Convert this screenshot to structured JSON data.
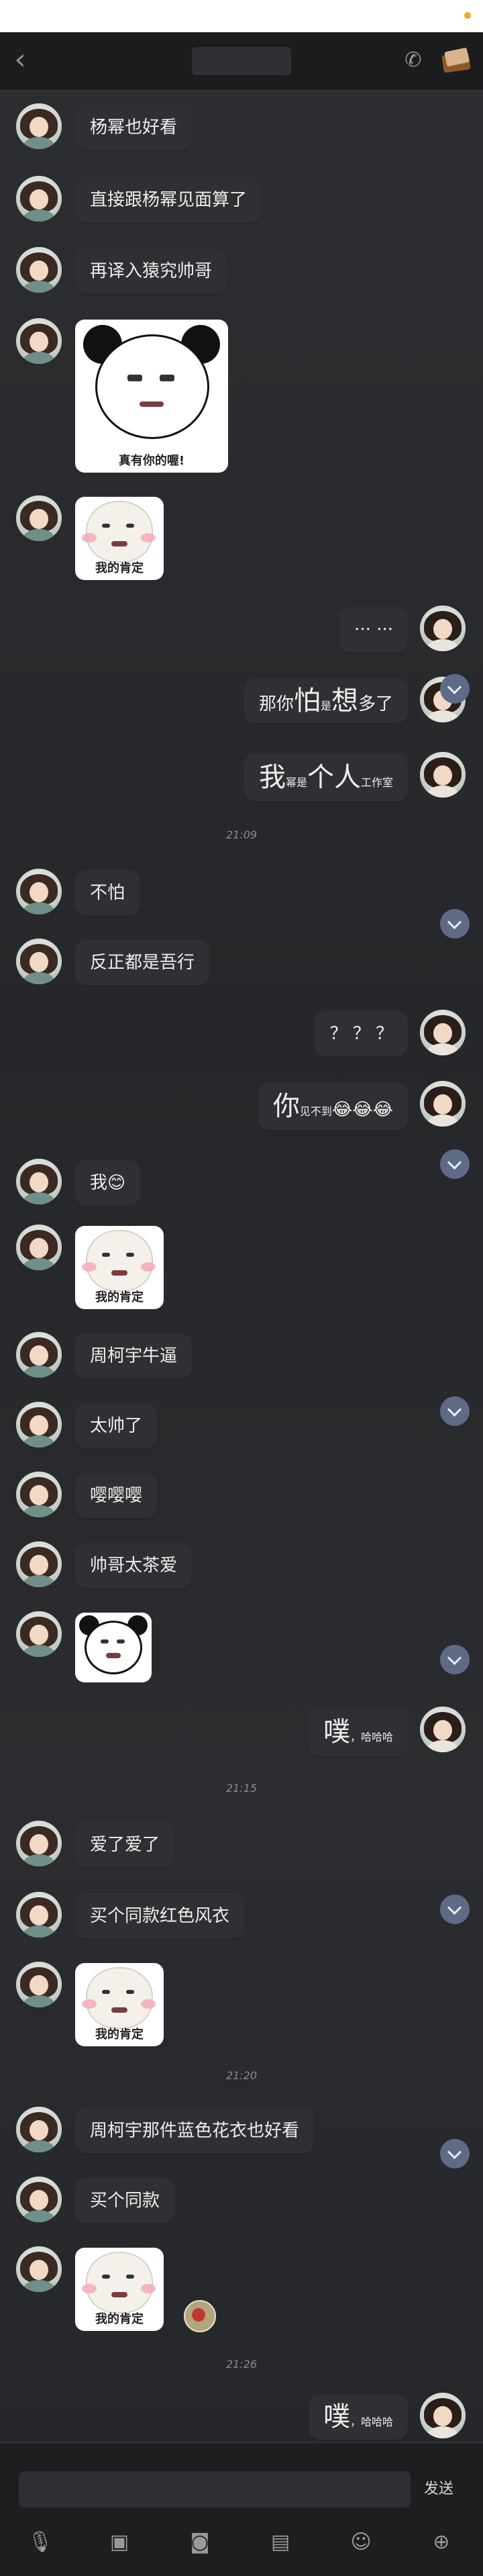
{
  "titlebar": {
    "back_icon": "chevron-left-icon",
    "title": "",
    "phone_icon": "phone-icon",
    "album_icon": "photo-album-icon"
  },
  "messages": [
    {
      "side": "left",
      "type": "text",
      "text": "杨幂也好看"
    },
    {
      "side": "left",
      "type": "text",
      "text": "直接跟杨幂见面算了"
    },
    {
      "side": "left",
      "type": "text",
      "text": "再译入猿究帅哥"
    },
    {
      "side": "left",
      "type": "sticker",
      "caption": "真有你的喔!"
    },
    {
      "side": "left",
      "type": "sticker",
      "caption": "我的肯定"
    },
    {
      "side": "right",
      "type": "text",
      "text": "··· ···"
    },
    {
      "side": "right",
      "type": "text",
      "text_a": "那你",
      "text_b": "怕",
      "text_c": "是",
      "text_d": "想",
      "text_e": "多了"
    },
    {
      "side": "right",
      "type": "text",
      "text_a": "我",
      "text_b": "幂是",
      "text_c": "个人",
      "text_d": "工作室"
    },
    {
      "time": "21:09"
    },
    {
      "side": "left",
      "type": "text",
      "text": "不怕"
    },
    {
      "side": "left",
      "type": "text",
      "text": "反正都是吾行"
    },
    {
      "side": "right",
      "type": "text",
      "text": "？ ？ ？"
    },
    {
      "side": "right",
      "type": "text",
      "text_a": "你",
      "text_b": "见不到",
      "text_c": "😂😂😂"
    },
    {
      "side": "left",
      "type": "text",
      "text": "我",
      "emoji": "😊"
    },
    {
      "side": "left",
      "type": "sticker",
      "caption": "我的肯定"
    },
    {
      "side": "left",
      "type": "text",
      "text": "周柯宇牛逼"
    },
    {
      "side": "left",
      "type": "text",
      "text": "太帅了"
    },
    {
      "side": "left",
      "type": "text",
      "text": "嘤嘤嘤"
    },
    {
      "side": "left",
      "type": "text",
      "text": "帅哥太茶爱"
    },
    {
      "side": "left",
      "type": "sticker",
      "caption": ""
    },
    {
      "side": "right",
      "type": "text",
      "text_a": "噗",
      "text_b": "，哈哈哈"
    },
    {
      "time": "21:15"
    },
    {
      "side": "left",
      "type": "text",
      "text": "爱了爱了"
    },
    {
      "side": "left",
      "type": "text",
      "text": "买个同款红色风衣"
    },
    {
      "side": "left",
      "type": "sticker",
      "caption": "我的肯定"
    },
    {
      "time": "21:20"
    },
    {
      "side": "left",
      "type": "text",
      "text": "周柯宇那件蓝色花衣也好看"
    },
    {
      "side": "left",
      "type": "text",
      "text": "买个同款"
    },
    {
      "side": "left",
      "type": "sticker",
      "caption": "我的肯定"
    },
    {
      "time": "21:26"
    },
    {
      "side": "right",
      "type": "text",
      "text_a": "噗",
      "text_b": "，哈哈哈"
    }
  ],
  "input": {
    "placeholder": "",
    "send_label": "发送"
  },
  "toolbar": {
    "icons": [
      "microphone-icon",
      "image-icon",
      "camera-icon",
      "wallet-icon",
      "emoji-icon",
      "plus-icon"
    ]
  }
}
